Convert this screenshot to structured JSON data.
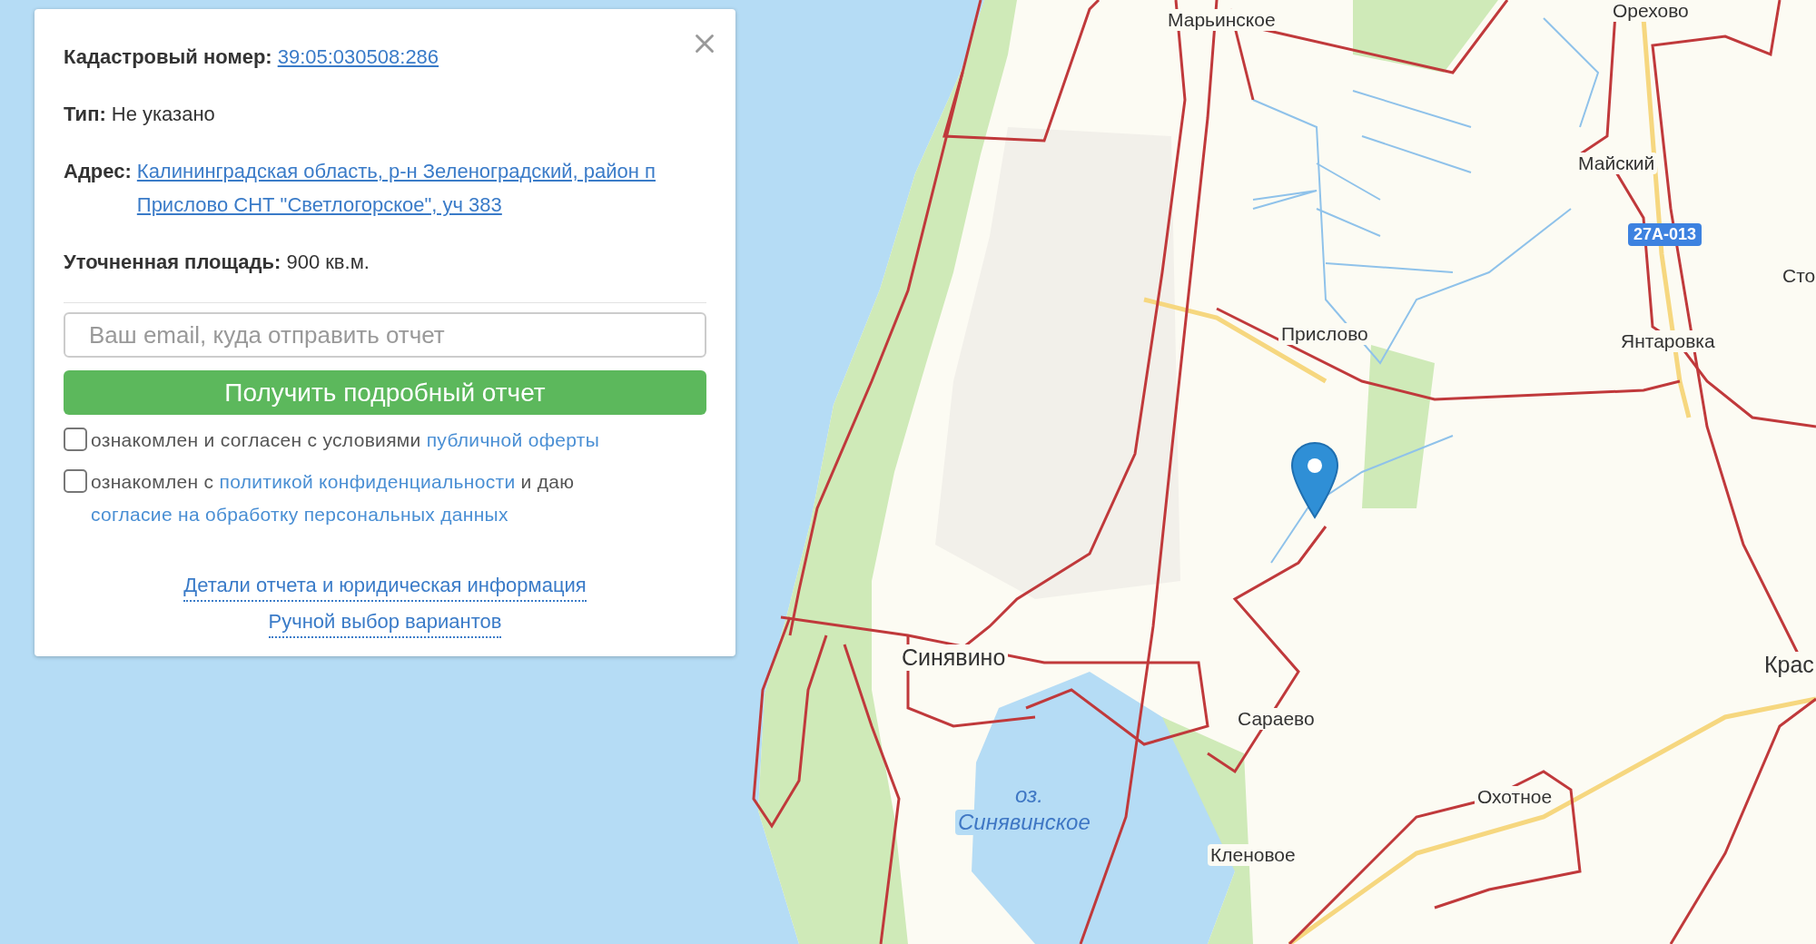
{
  "map": {
    "labels": [
      {
        "text": "Марьинское",
        "kind": "place"
      },
      {
        "text": "Орехово",
        "kind": "place"
      },
      {
        "text": "Майский",
        "kind": "place"
      },
      {
        "text": "27А-013",
        "kind": "road"
      },
      {
        "text": "Сто",
        "kind": "place"
      },
      {
        "text": "Прислово",
        "kind": "place"
      },
      {
        "text": "Янтаровка",
        "kind": "place"
      },
      {
        "text": "Синявино",
        "kind": "town"
      },
      {
        "text": "Сараево",
        "kind": "place"
      },
      {
        "text": "оз.",
        "kind": "water"
      },
      {
        "text": "Синявинское",
        "kind": "water"
      },
      {
        "text": "Кленовое",
        "kind": "place"
      },
      {
        "text": "Охотное",
        "kind": "place"
      },
      {
        "text": "Крас",
        "kind": "town"
      }
    ]
  },
  "card": {
    "fields": [
      {
        "label": "Кадастровый номер:",
        "value": "39:05:030508:286",
        "kind": "link"
      },
      {
        "label": "Тип:",
        "value": "Не указано",
        "kind": "plain"
      },
      {
        "label": "Адрес:",
        "value": "Калининградская область, р-н Зеленоградский, район п Прислово СНТ \"Светлогорское\", уч 383",
        "kind": "link"
      },
      {
        "label": "Уточненная площадь:",
        "value": "900 кв.м.",
        "kind": "plain"
      }
    ],
    "email_field": {
      "placeholder": "Ваш email, куда отправить отчет"
    },
    "submit_button": "Получить подробный отчет",
    "consents": [
      {
        "checked": false,
        "parts": [
          {
            "text": "ознакомлен и согласен с условиями ",
            "link": false
          },
          {
            "text": "публичной оферты",
            "link": true
          }
        ]
      },
      {
        "checked": false,
        "parts": [
          {
            "text": "ознакомлен с ",
            "link": false
          },
          {
            "text": "политикой конфиденциальности",
            "link": true
          },
          {
            "text": " и даю ",
            "link": false
          },
          {
            "text": "согласие на обработку персональных данных",
            "link": true
          }
        ]
      }
    ],
    "links": [
      "Детали отчета и юридическая информация",
      "Ручной выбор вариантов"
    ]
  }
}
